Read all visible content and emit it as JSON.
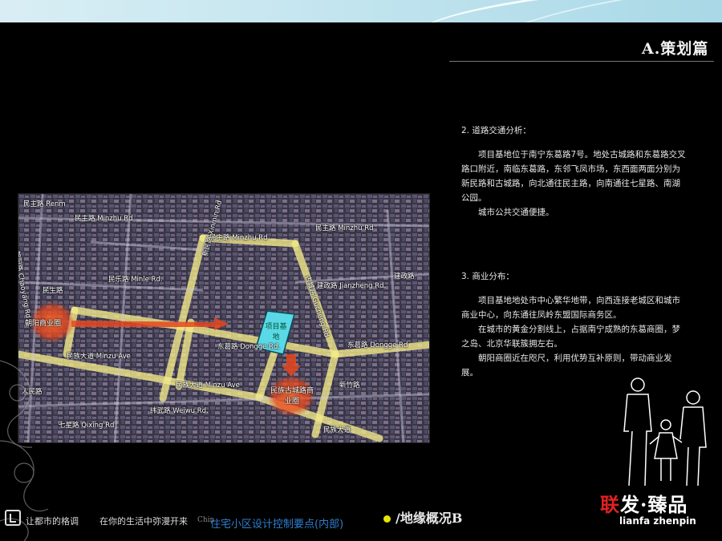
{
  "section_title": "A.策划篇",
  "text": {
    "traffic_heading": "2. 道路交通分析：",
    "traffic_p1": "项目基地位于南宁东葛路7号。地处古城路和东葛路交叉路口附近，南临东葛路，东邻飞凤市场，东西面两面分别为新民路和古城路，向北通往民主路，向南通往七星路、南湖公园。",
    "traffic_p2": "城市公共交通便捷。",
    "commerce_heading": "3. 商业分布：",
    "commerce_p1": "项目基地地处市中心繁华地带，向西连接老城区和城市商业中心，向东通往凤岭东盟国际商务区。",
    "commerce_p2": "在城市的黄金分割线上，占据南宁成熟的东葛商圈，梦之岛、北京华联簇拥左右。",
    "commerce_p3": "朝阳商圈近在咫尺，利用优势互补原则，带动商业发展。"
  },
  "map": {
    "labels": {
      "minzhu_top_left": "民主路 Renm",
      "minzhu_left": "民主路 Minzhu Rd",
      "minzhu_mid": "民主路 Minzhu Rd",
      "minzhu_right": "民主路 Minzhu Rd",
      "minle": "民乐路 Minle Rd.",
      "minsheng": "民生路",
      "chaoyang": "朝阳路 Chaoyang Rd",
      "jianzheng": "建政路 Jianzheng Rd.",
      "jianzheng_right": "建政路",
      "dongge_mid": "东葛路 Dongge Rd.",
      "dongge_right": "东葛路 Dongge Rd",
      "minzu_left": "民族大道 Minzu Ave",
      "minzu_mid": "民族大道 Minzu Ave",
      "minzu_right": "民族大道",
      "weiwu": "纬武路 Weiwu Rd.",
      "qixing": "七星路 Qixing Rd",
      "xinzhu": "新竹路",
      "gucheng": "古城路 Gucheng Rd",
      "xinmin": "新民路 Xinmin Rd",
      "shaoping": "人民路",
      "zone_chaoyang": "朝阳商业圈",
      "zone_project": "项目基地",
      "zone_minzu": "民族古城路商业圈"
    }
  },
  "footer": {
    "slogan_1": "让都市的格调",
    "slogan_2": "在你的生活中弥漫开来",
    "slogan_en": "Chin",
    "caption": "住宅小区设计控制要点(内部)",
    "subsection": "/地缘概况B",
    "brand_cn_1": "联",
    "brand_cn_2": "发·臻品",
    "brand_en": "lianfa zhenpin"
  },
  "colors": {
    "accent_dot": "#e6e600",
    "road": "#f2ea8a",
    "zone": "#e8471e",
    "project": "#5ad8e6",
    "caption": "#2f7fd0"
  }
}
